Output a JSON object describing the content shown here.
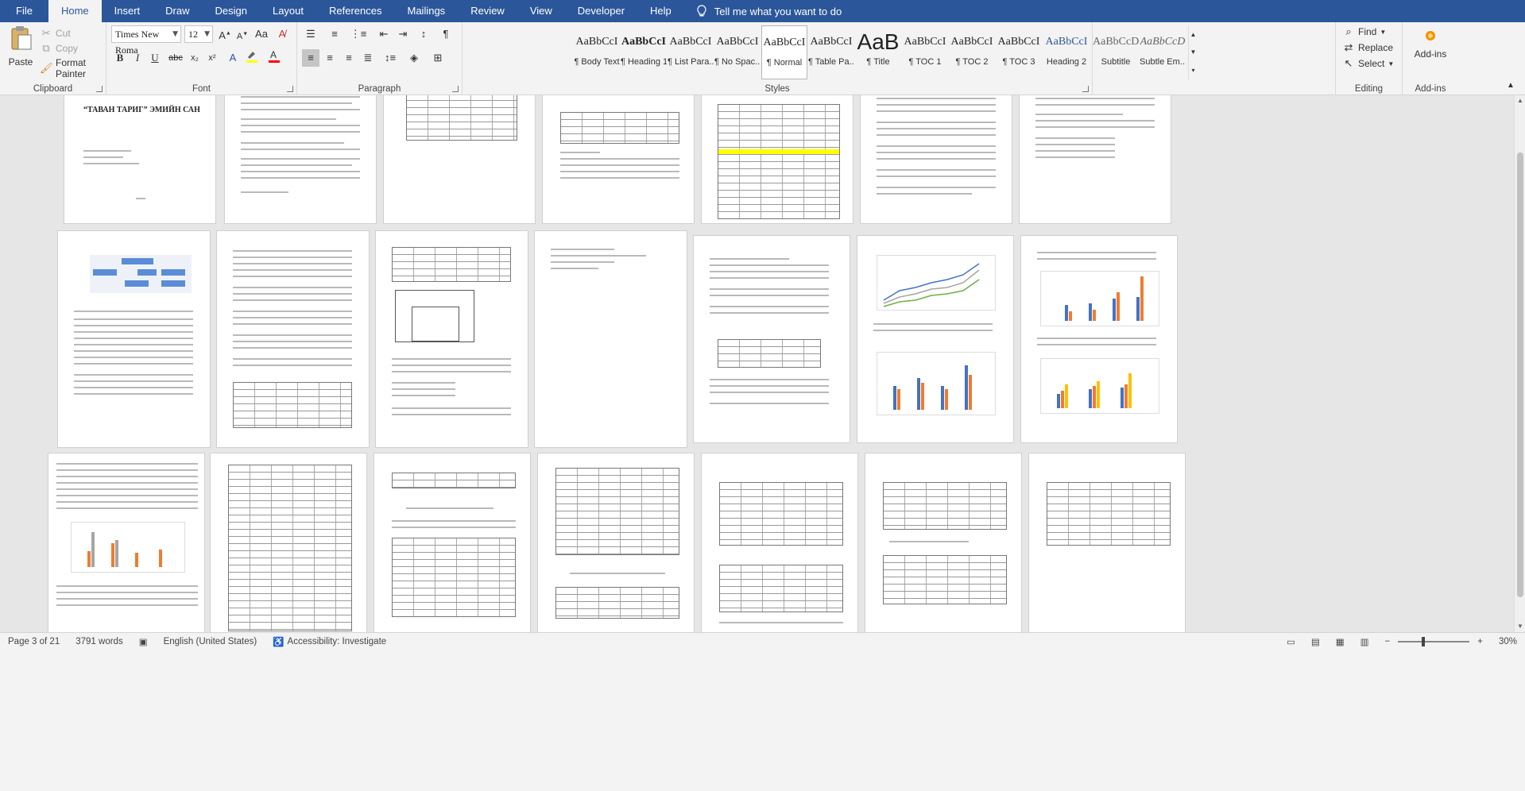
{
  "menu": {
    "tabs": [
      "File",
      "Home",
      "Insert",
      "Draw",
      "Design",
      "Layout",
      "References",
      "Mailings",
      "Review",
      "View",
      "Developer",
      "Help"
    ],
    "active_tab": "Home",
    "tell_me": "Tell me what you want to do"
  },
  "clipboard": {
    "label": "Clipboard",
    "paste": "Paste",
    "cut": "Cut",
    "copy": "Copy",
    "format_painter": "Format Painter"
  },
  "font": {
    "label": "Font",
    "family": "Times New Roma",
    "size": "12",
    "bold": "B",
    "italic": "I",
    "underline": "U",
    "strike": "abc",
    "subscript": "x₂",
    "superscript": "x²"
  },
  "paragraph": {
    "label": "Paragraph"
  },
  "styles": {
    "label": "Styles",
    "items": [
      {
        "preview": "AaBbCcI",
        "name": "¶ Body Text"
      },
      {
        "preview": "AaBbCcI",
        "name": "¶ Heading 1"
      },
      {
        "preview": "AaBbCcI",
        "name": "¶ List Para..."
      },
      {
        "preview": "AaBbCcI",
        "name": "¶ No Spac..."
      },
      {
        "preview": "AaBbCcI",
        "name": "¶ Normal"
      },
      {
        "preview": "AaBbCcI",
        "name": "¶ Table Pa..."
      },
      {
        "preview": "AaB",
        "name": "¶ Title"
      },
      {
        "preview": "AaBbCcI",
        "name": "¶ TOC 1"
      },
      {
        "preview": "AaBbCcI",
        "name": "¶ TOC 2"
      },
      {
        "preview": "AaBbCcI",
        "name": "¶ TOC 3"
      },
      {
        "preview": "AaBbCcI",
        "name": "Heading 2"
      },
      {
        "preview": "AaBbCcD",
        "name": "Subtitle"
      },
      {
        "preview": "AaBbCcD",
        "name": "Subtle Em..."
      }
    ],
    "selected": "¶ Normal"
  },
  "editing": {
    "label": "Editing",
    "find": "Find",
    "replace": "Replace",
    "select": "Select"
  },
  "addins": {
    "label": "Add-ins",
    "button": "Add-ins"
  },
  "document": {
    "cover_title": "“ТАВАН ТАРИГ” ЭМИЙН САН"
  },
  "status": {
    "page": "Page 3 of 21",
    "words": "3791 words",
    "language": "English (United States)",
    "accessibility": "Accessibility: Investigate",
    "zoom": "30%"
  },
  "colors": {
    "accent": "#2b579a",
    "ribbon_bg": "#f3f3f3",
    "doc_bg": "#e6e6e6",
    "highlight": "#ffff00",
    "font_color": "#ff0000"
  }
}
